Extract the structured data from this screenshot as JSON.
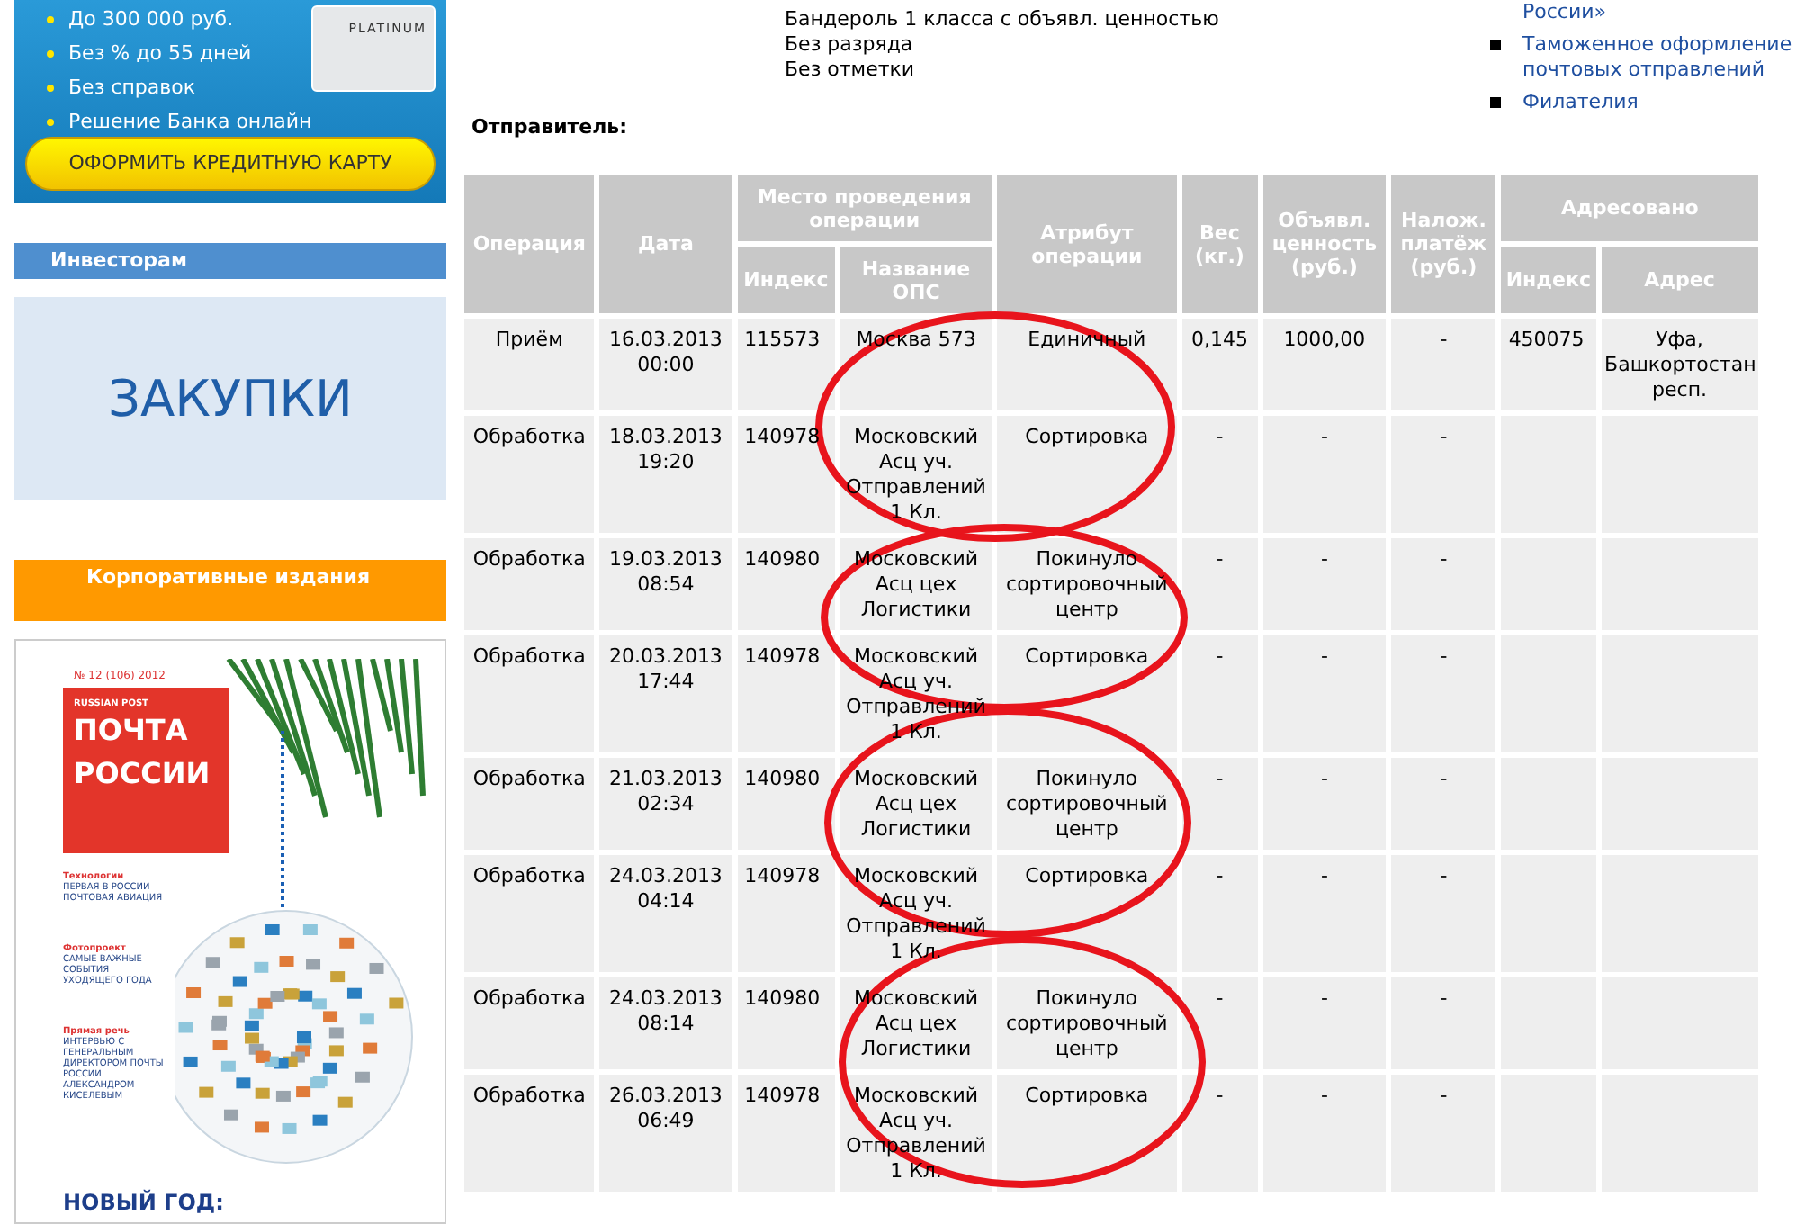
{
  "ad_banner": {
    "bullets": [
      "До 300 000 руб.",
      "Без % до 55 дней",
      "Без справок",
      "Решение Банка онлайн"
    ],
    "card_text": "PLATINUM",
    "button": "ОФОРМИТЬ КРЕДИТНУЮ КАРТУ"
  },
  "investors": {
    "title": "Инвесторам",
    "banner_text": "ЗАКУПКИ"
  },
  "corporate": {
    "title": "Корпоративные издания",
    "cover": {
      "issue": "№ 12 (106) 2012",
      "brand": "RUSSIAN POST",
      "title_lines": [
        "ПОЧТА",
        "РОССИИ"
      ],
      "sections": [
        {
          "title": "Технологии",
          "text": "ПЕРВАЯ В РОССИИ ПОЧТОВАЯ АВИАЦИЯ"
        },
        {
          "title": "Фотопроект",
          "text": "САМЫЕ ВАЖНЫЕ СОБЫТИЯ УХОДЯЩЕГО ГОДА"
        },
        {
          "title": "Прямая речь",
          "text": "ИНТЕРВЬЮ С ГЕНЕРАЛЬНЫМ ДИРЕКТОРОМ ПОЧТЫ РОССИИ АЛЕКСАНДРОМ КИСЕЛЕВЫМ"
        }
      ],
      "headline": "НОВЫЙ ГОД:"
    }
  },
  "shipment": {
    "details": [
      "Бандероль 1 класса с объявл. ценностью",
      "Без разряда",
      "Без отметки"
    ],
    "sender_label": "Отправитель:"
  },
  "links": [
    {
      "kind": "continuation",
      "text": "России»"
    },
    {
      "kind": "item",
      "text": "Таможенное оформление почтовых отправлений"
    },
    {
      "kind": "item",
      "text": "Филателия"
    }
  ],
  "table": {
    "columns": [
      {
        "label": "Операция"
      },
      {
        "label": "Дата"
      },
      {
        "label": "Место проведения операции",
        "children": [
          {
            "label": "Индекс"
          },
          {
            "label": "Название ОПС"
          }
        ]
      },
      {
        "label": "Атрибут операции"
      },
      {
        "label": "Вес (кг.)"
      },
      {
        "label": "Объявл. ценность (руб.)"
      },
      {
        "label": "Налож. платёж (руб.)"
      },
      {
        "label": "Адресовано",
        "children": [
          {
            "label": "Индекс"
          },
          {
            "label": "Адрес"
          }
        ]
      }
    ],
    "rows": [
      {
        "operation": "Приём",
        "date": "16.03.2013 00:00",
        "index": "115573",
        "office": "Москва 573",
        "attribute": "Единичный",
        "weight": "0,145",
        "declared_value": "1000,00",
        "cod": "-",
        "to_index": "450075",
        "to_address": "Уфа, Башкортостан респ."
      },
      {
        "operation": "Обработка",
        "date": "18.03.2013 19:20",
        "index": "140978",
        "office": "Московский Асц уч. Отправлений 1 Кл.",
        "attribute": "Сортировка",
        "weight": "-",
        "declared_value": "-",
        "cod": "-"
      },
      {
        "operation": "Обработка",
        "date": "19.03.2013 08:54",
        "index": "140980",
        "office": "Московский Асц цех Логистики",
        "attribute": "Покинуло сортировочный центр",
        "weight": "-",
        "declared_value": "-",
        "cod": "-"
      },
      {
        "operation": "Обработка",
        "date": "20.03.2013 17:44",
        "index": "140978",
        "office": "Московский Асц уч. Отправлений 1 Кл.",
        "attribute": "Сортировка",
        "weight": "-",
        "declared_value": "-",
        "cod": "-"
      },
      {
        "operation": "Обработка",
        "date": "21.03.2013 02:34",
        "index": "140980",
        "office": "Московский Асц цех Логистики",
        "attribute": "Покинуло сортировочный центр",
        "weight": "-",
        "declared_value": "-",
        "cod": "-"
      },
      {
        "operation": "Обработка",
        "date": "24.03.2013 04:14",
        "index": "140978",
        "office": "Московский Асц уч. Отправлений 1 Кл.",
        "attribute": "Сортировка",
        "weight": "-",
        "declared_value": "-",
        "cod": "-"
      },
      {
        "operation": "Обработка",
        "date": "24.03.2013 08:14",
        "index": "140980",
        "office": "Московский Асц цех Логистики",
        "attribute": "Покинуло сортировочный центр",
        "weight": "-",
        "declared_value": "-",
        "cod": "-"
      },
      {
        "operation": "Обработка",
        "date": "26.03.2013 06:49",
        "index": "140978",
        "office": "Московский Асц уч. Отправлений 1 Кл.",
        "attribute": "Сортировка",
        "weight": "-",
        "declared_value": "-",
        "cod": "-"
      }
    ]
  }
}
